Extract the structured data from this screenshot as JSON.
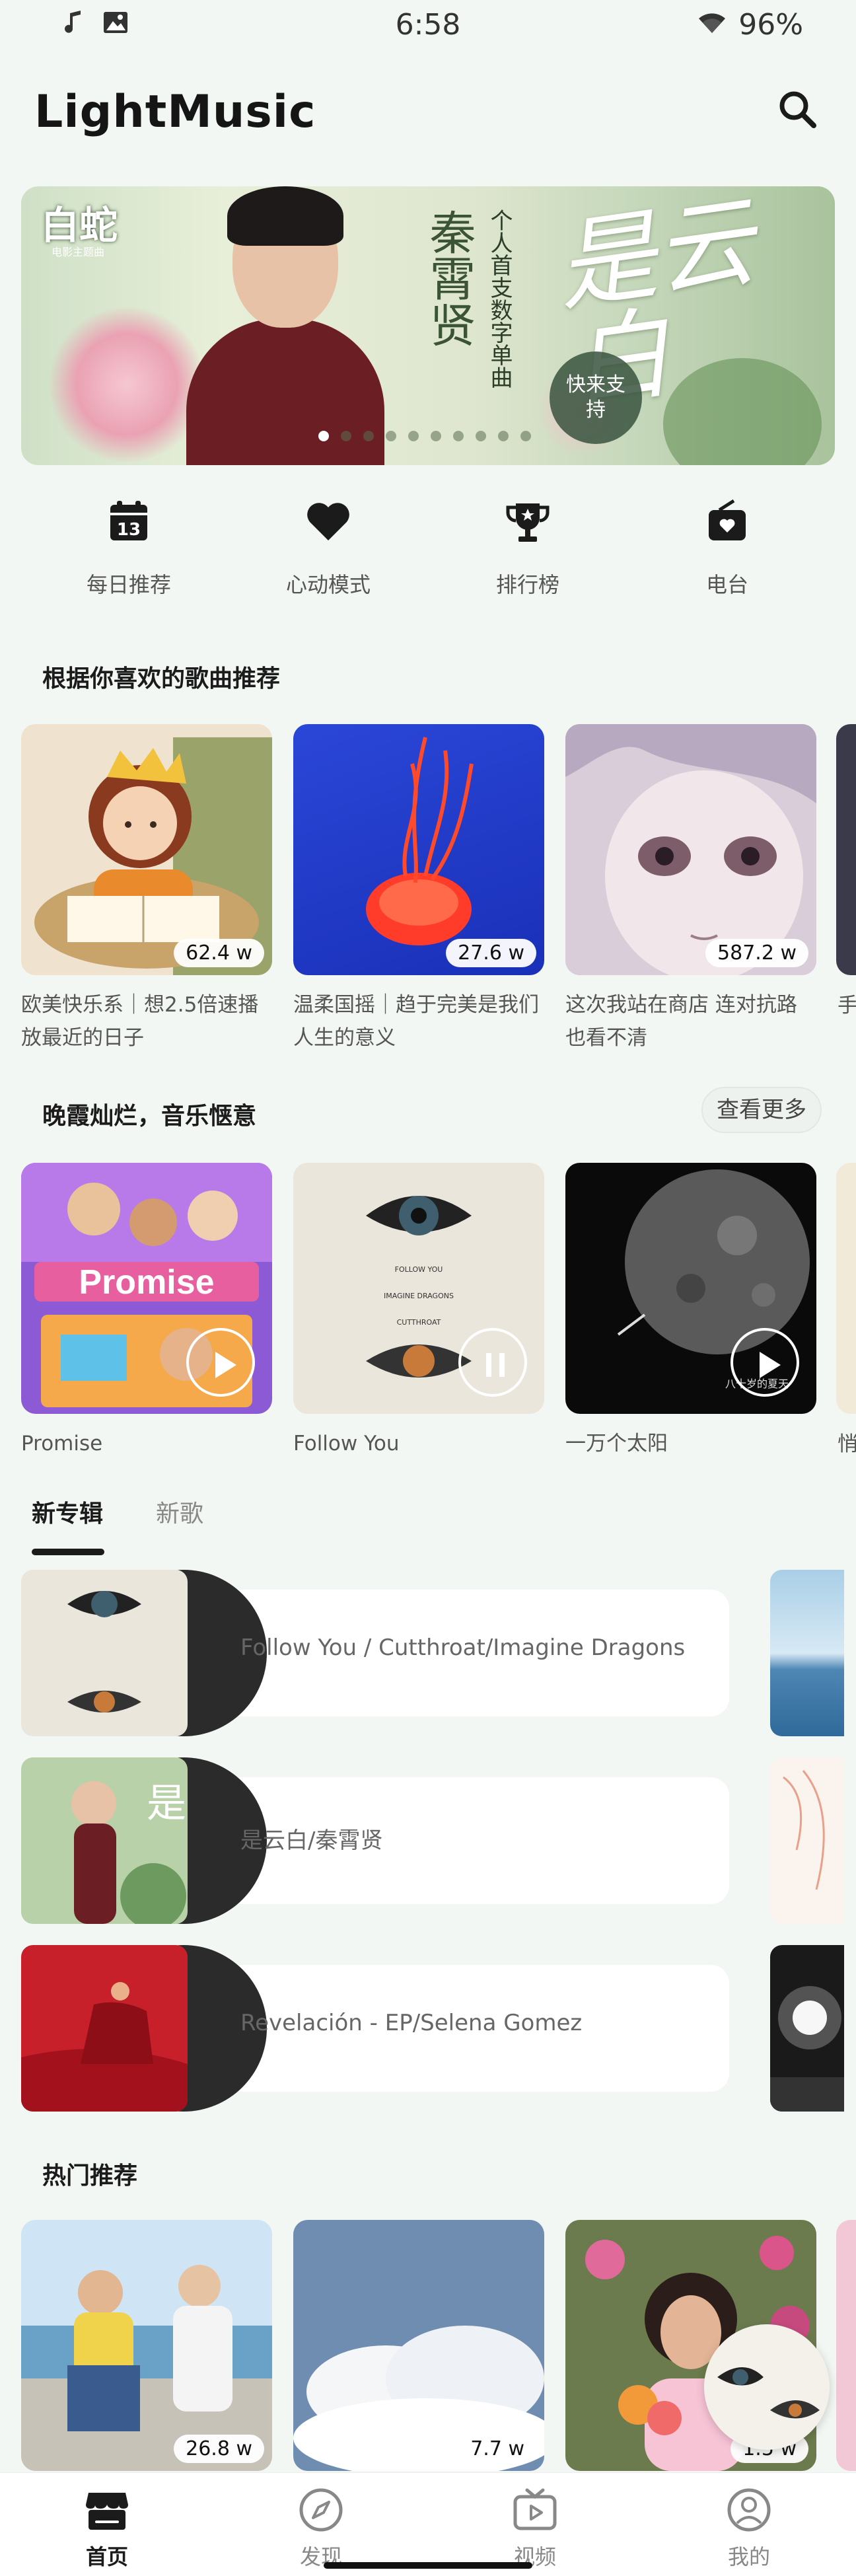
{
  "status_bar": {
    "time": "6:58",
    "battery": "96%",
    "icons": [
      "music-note-icon",
      "image-icon",
      "wifi-icon"
    ]
  },
  "header": {
    "title": "LightMusic",
    "search_icon": "search-icon"
  },
  "banner": {
    "logo": "白蛇",
    "logo_sub": "电影主题曲",
    "artist": "秦霄贤",
    "subtitle": "个人首支数字单曲",
    "title": "是云白",
    "seal": "快来支持",
    "dots_total": 10,
    "dots_active": 0
  },
  "quick_entries": [
    {
      "label": "每日推荐",
      "icon": "calendar-icon",
      "day": "13"
    },
    {
      "label": "心动模式",
      "icon": "heart-icon"
    },
    {
      "label": "排行榜",
      "icon": "trophy-icon"
    },
    {
      "label": "电台",
      "icon": "radio-icon"
    }
  ],
  "recommend": {
    "title": "根据你喜欢的歌曲推荐",
    "items": [
      {
        "title": "欧美快乐系｜想2.5倍速播放最近的日子",
        "count": "62.4 w"
      },
      {
        "title": "温柔国摇｜趋于完美是我们人生的意义",
        "count": "27.6 w"
      },
      {
        "title": "这次我站在商店 连对抗路也看不清",
        "count": "587.2 w"
      }
    ],
    "peek_title": "手"
  },
  "sunset": {
    "title": "晚霞灿烂，音乐惬意",
    "more": "查看更多",
    "items": [
      {
        "title": "Promise",
        "state": "play"
      },
      {
        "title": "Follow You",
        "state": "pause"
      },
      {
        "title": "一万个太阳",
        "state": "play"
      }
    ],
    "peek_title": "悄"
  },
  "tabs": [
    {
      "label": "新专辑",
      "active": true
    },
    {
      "label": "新歌",
      "active": false
    }
  ],
  "albums": [
    {
      "name": "Follow You / Cutthroat/Imagine Dragons"
    },
    {
      "name": "是云白/秦霄贤"
    },
    {
      "name": "Revelación - EP/Selena Gomez"
    }
  ],
  "hot": {
    "title": "热门推荐",
    "items": [
      {
        "count": "26.8 w"
      },
      {
        "count": "7.7 w"
      },
      {
        "count": "1.5 w"
      }
    ]
  },
  "bottom_nav": [
    {
      "label": "首页",
      "icon": "home-icon",
      "active": true
    },
    {
      "label": "发现",
      "icon": "compass-icon",
      "active": false
    },
    {
      "label": "视频",
      "icon": "video-icon",
      "active": false
    },
    {
      "label": "我的",
      "icon": "profile-icon",
      "active": false
    }
  ]
}
